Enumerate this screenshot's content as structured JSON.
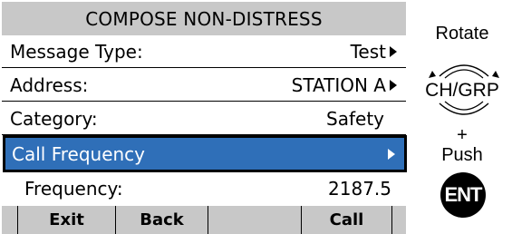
{
  "screen": {
    "title": "COMPOSE NON-DISTRESS",
    "rows": [
      {
        "label": "Message Type:",
        "value": "Test"
      },
      {
        "label": "Address:",
        "value": "STATION A"
      },
      {
        "label": "Category:",
        "value": "Safety"
      },
      {
        "label": "Call Frequency",
        "value": ""
      },
      {
        "label": "Frequency:",
        "value": "2187.5"
      }
    ],
    "softkeys": [
      "",
      "Exit",
      "Back",
      "",
      "Call",
      ""
    ]
  },
  "controls": {
    "rotate_label": "Rotate",
    "knob_label": "CH/GRP",
    "plus_label": "+",
    "push_label": "Push",
    "ent_label": "ENT"
  }
}
